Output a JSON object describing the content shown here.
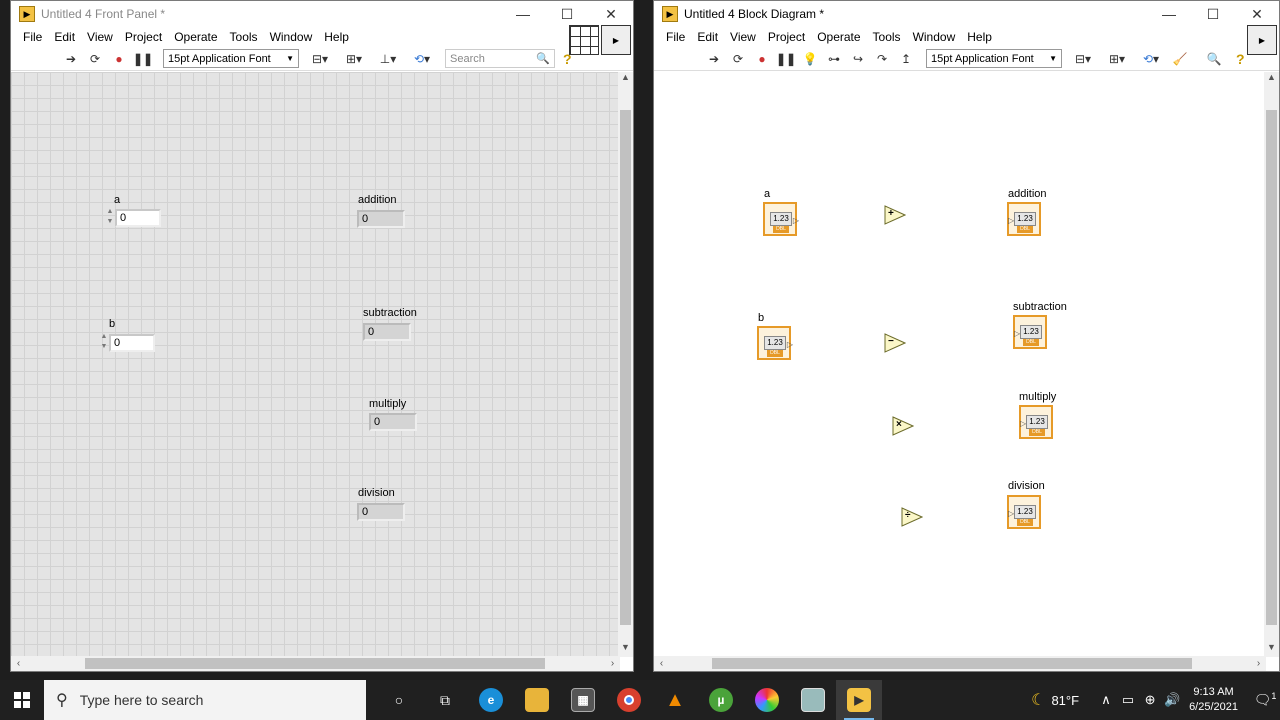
{
  "front_panel": {
    "title": "Untitled 4 Front Panel *",
    "menu": [
      "File",
      "Edit",
      "View",
      "Project",
      "Operate",
      "Tools",
      "Window",
      "Help"
    ],
    "font": "15pt Application Font",
    "search_placeholder": "Search",
    "controls": [
      {
        "label": "a",
        "value": "0"
      },
      {
        "label": "b",
        "value": "0"
      }
    ],
    "indicators": [
      {
        "label": "addition",
        "value": "0"
      },
      {
        "label": "subtraction",
        "value": "0"
      },
      {
        "label": "multiply",
        "value": "0"
      },
      {
        "label": "division",
        "value": "0"
      }
    ]
  },
  "block_diagram": {
    "title": "Untitled 4 Block Diagram *",
    "menu": [
      "File",
      "Edit",
      "View",
      "Project",
      "Operate",
      "Tools",
      "Window",
      "Help"
    ],
    "font": "15pt Application Font",
    "terminal_text": "1.23",
    "terminal_type": "DBL",
    "controls": [
      "a",
      "b"
    ],
    "indicators": [
      "addition",
      "subtraction",
      "multiply",
      "division"
    ],
    "functions": [
      "+",
      "−",
      "×",
      "÷"
    ]
  },
  "taskbar": {
    "search_placeholder": "Type here to search",
    "temperature": "81°F",
    "time": "9:13 AM",
    "date": "6/25/2021",
    "notification_count": "1"
  }
}
